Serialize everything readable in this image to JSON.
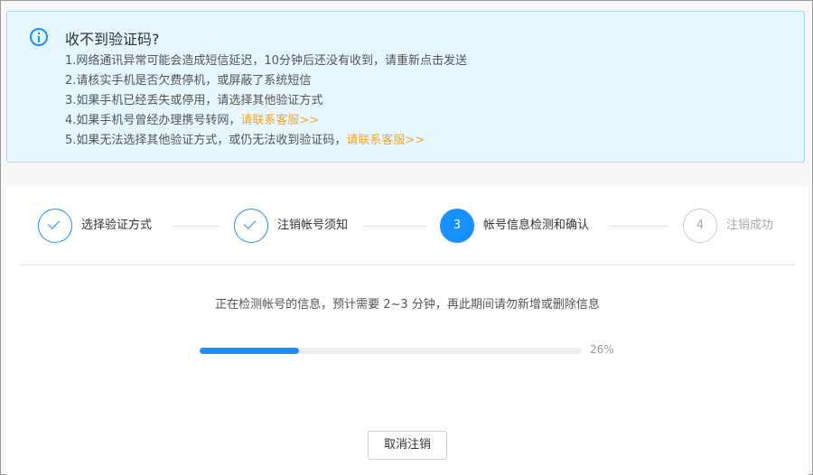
{
  "notice": {
    "icon": "info-circle-icon",
    "title": "收不到验证码?",
    "items": [
      {
        "text": "1.网络通讯异常可能会造成短信延迟，10分钟后还没有收到，请重新点击发送",
        "link": ""
      },
      {
        "text": "2.请核实手机是否欠费停机，或屏蔽了系统短信",
        "link": ""
      },
      {
        "text": "3.如果手机已经丢失或停用，请选择其他验证方式",
        "link": ""
      },
      {
        "text": "4.如果手机号曾经办理携号转网，",
        "link": "请联系客服>>"
      },
      {
        "text": "5.如果无法选择其他验证方式，或仍无法收到验证码，",
        "link": "请联系客服>>"
      }
    ],
    "accent_color": "#1890ff",
    "link_color": "#f5a623"
  },
  "steps": [
    {
      "marker": "check-icon",
      "label": "选择验证方式",
      "state": "done"
    },
    {
      "marker": "check-icon",
      "label": "注销帐号须知",
      "state": "done"
    },
    {
      "number": "3",
      "label": "帐号信息检测和确认",
      "state": "active"
    },
    {
      "number": "4",
      "label": "注销成功",
      "state": "todo"
    }
  ],
  "status": {
    "message": "正在检测帐号的信息，预计需要 2~3 分钟，再此期间请勿新增或删除信息",
    "progress": 0.26,
    "progress_label": "26%"
  },
  "actions": {
    "cancel_label": "取消注销"
  }
}
